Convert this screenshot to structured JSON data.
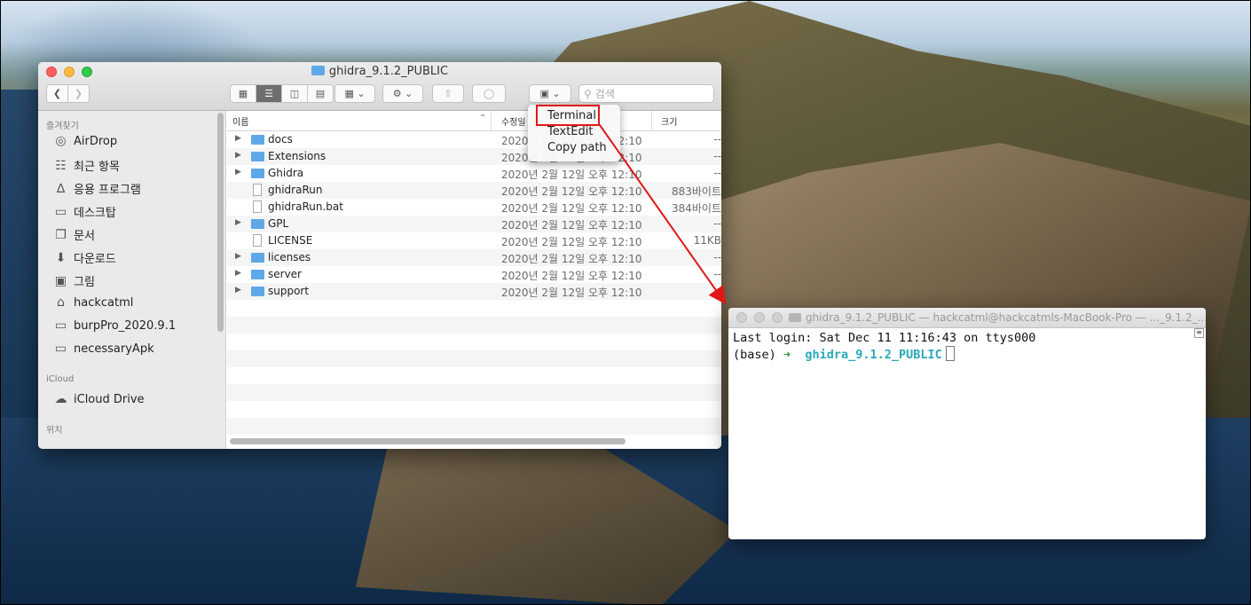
{
  "finder": {
    "title": "ghidra_9.1.2_PUBLIC",
    "search_placeholder": "검색",
    "view_icons": [
      "grid-view-icon",
      "list-view-icon",
      "column-view-icon",
      "gallery-view-icon"
    ],
    "columns": {
      "name": "이름",
      "date": "수정일",
      "size": "크기"
    },
    "sidebar": {
      "favorites_header": "즐겨찾기",
      "favorites": [
        {
          "label": "AirDrop",
          "icon": "airdrop-icon"
        },
        {
          "label": "최근 항목",
          "icon": "recents-icon"
        },
        {
          "label": "응용 프로그램",
          "icon": "applications-icon"
        },
        {
          "label": "데스크탑",
          "icon": "desktop-icon"
        },
        {
          "label": "문서",
          "icon": "documents-icon"
        },
        {
          "label": "다운로드",
          "icon": "downloads-icon"
        },
        {
          "label": "그림",
          "icon": "pictures-icon"
        },
        {
          "label": "hackcatml",
          "icon": "home-icon"
        },
        {
          "label": "burpPro_2020.9.1",
          "icon": "folder-icon"
        },
        {
          "label": "necessaryApk",
          "icon": "folder-icon"
        }
      ],
      "icloud_header": "iCloud",
      "icloud": [
        {
          "label": "iCloud Drive",
          "icon": "cloud-icon"
        }
      ],
      "locations_header": "위치"
    },
    "files": [
      {
        "name": "docs",
        "kind": "folder",
        "date": "2020년 2월 12일 오후 12:10",
        "size": "--"
      },
      {
        "name": "Extensions",
        "kind": "folder",
        "date": "2020년 2월 12일 오후 12:10",
        "size": "--"
      },
      {
        "name": "Ghidra",
        "kind": "folder",
        "date": "2020년 2월 12일 오후 12:10",
        "size": "--"
      },
      {
        "name": "ghidraRun",
        "kind": "file",
        "date": "2020년 2월 12일 오후 12:10",
        "size": "883바이트"
      },
      {
        "name": "ghidraRun.bat",
        "kind": "file",
        "date": "2020년 2월 12일 오후 12:10",
        "size": "384바이트"
      },
      {
        "name": "GPL",
        "kind": "folder",
        "date": "2020년 2월 12일 오후 12:10",
        "size": "--"
      },
      {
        "name": "LICENSE",
        "kind": "file",
        "date": "2020년 2월 12일 오후 12:10",
        "size": "11KB"
      },
      {
        "name": "licenses",
        "kind": "folder",
        "date": "2020년 2월 12일 오후 12:10",
        "size": "--"
      },
      {
        "name": "server",
        "kind": "folder",
        "date": "2020년 2월 12일 오후 12:10",
        "size": "--"
      },
      {
        "name": "support",
        "kind": "folder",
        "date": "2020년 2월 12일 오후 12:10",
        "size": "--"
      }
    ]
  },
  "context_menu": {
    "items": [
      "Terminal",
      "TextEdit",
      "Copy path"
    ],
    "highlighted": "Terminal"
  },
  "terminal": {
    "title": "ghidra_9.1.2_PUBLIC — hackcatml@hackcatmls-MacBook-Pro — ..._9.1.2_...",
    "line1": "Last login: Sat Dec 11 11:16:43 on ttys000",
    "prompt_env": "(base)",
    "prompt_arrow": "➜",
    "prompt_dir": "ghidra_9.1.2_PUBLIC"
  },
  "colors": {
    "annotation": "#e01818",
    "folder": "#5fa8e8",
    "terminal_dir": "#28a9b8"
  }
}
